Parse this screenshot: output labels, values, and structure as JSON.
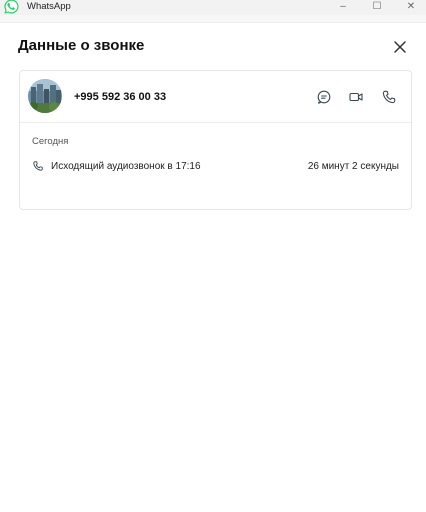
{
  "window": {
    "app_title": "WhatsApp",
    "min_glyph": "–",
    "max_glyph": "☐",
    "close_glyph": "✕"
  },
  "panel": {
    "title": "Данные о звонке"
  },
  "contact": {
    "phone": "+995 592 36 00 33"
  },
  "history": {
    "date_label": "Сегодня",
    "calls": [
      {
        "description": "Исходящий аудиозвонок в 17:16",
        "duration": "26 минут 2 секунды"
      }
    ]
  },
  "colors": {
    "brand": "#25d366",
    "icon": "#3b4a54"
  }
}
